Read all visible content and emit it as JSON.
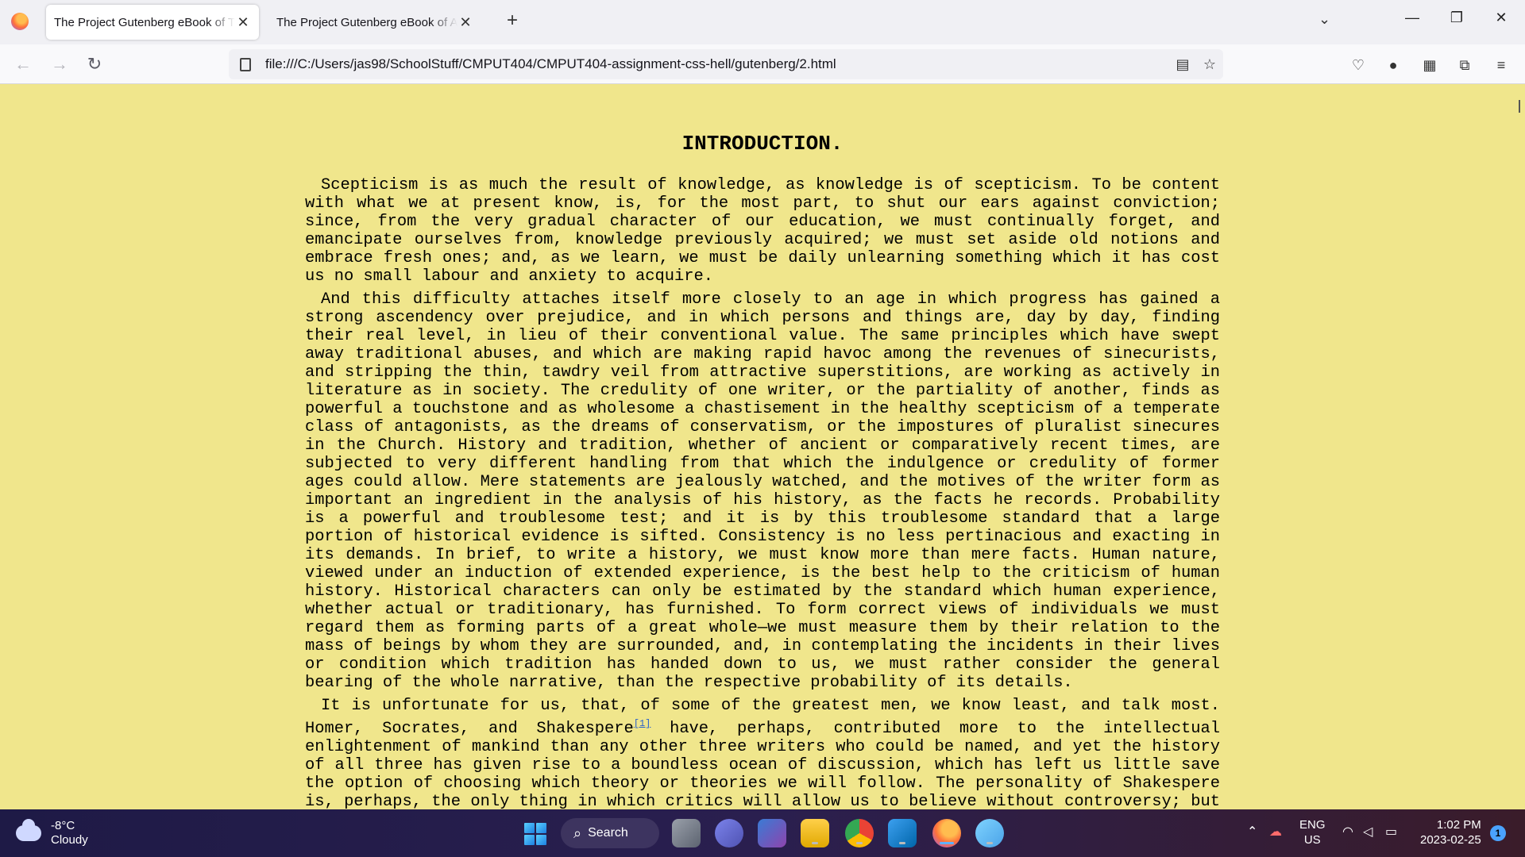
{
  "browser": {
    "tabs": [
      {
        "label": "The Project Gutenberg eBook of The",
        "active": true
      },
      {
        "label": "The Project Gutenberg eBook of An",
        "active": false
      }
    ],
    "url": "file:///C:/Users/jas98/SchoolStuff/CMPUT404/CMPUT404-assignment-css-hell/gutenberg/2.html"
  },
  "article": {
    "heading": "INTRODUCTION.",
    "p1": "Scepticism is as much the result of knowledge, as knowledge is of scepticism. To be content with what we at present know, is, for the most part, to shut our ears against conviction; since, from the very gradual character of our education, we must continually forget, and emancipate ourselves from, knowledge previously acquired; we must set aside old notions and embrace fresh ones; and, as we learn, we must be daily unlearning something which it has cost us no small labour and anxiety to acquire.",
    "p2": "And this difficulty attaches itself more closely to an age in which progress has gained a strong ascendency over prejudice, and in which persons and things are, day by day, finding their real level, in lieu of their conventional value. The same principles which have swept away traditional abuses, and which are making rapid havoc among the revenues of sinecurists, and stripping the thin, tawdry veil from attractive superstitions, are working as actively in literature as in society. The credulity of one writer, or the partiality of another, finds as powerful a touchstone and as wholesome a chastisement in the healthy scepticism of a temperate class of antagonists, as the dreams of conservatism, or the impostures of pluralist sinecures in the Church. History and tradition, whether of ancient or comparatively recent times, are subjected to very different handling from that which the indulgence or credulity of former ages could allow. Mere statements are jealously watched, and the motives of the writer form as important an ingredient in the analysis of his history, as the facts he records. Probability is a powerful and troublesome test; and it is by this troublesome standard that a large portion of historical evidence is sifted. Consistency is no less pertinacious and exacting in its demands. In brief, to write a history, we must know more than mere facts. Human nature, viewed under an induction of extended experience, is the best help to the criticism of human history. Historical characters can only be estimated by the standard which human experience, whether actual or traditionary, has furnished. To form correct views of individuals we must regard them as forming parts of a great whole—we must measure them by their relation to the mass of beings by whom they are surrounded, and, in contemplating the incidents in their lives or condition which tradition has handed down to us, we must rather consider the general bearing of the whole narrative, than the respective probability of its details.",
    "p3a": "It is unfortunate for us, that, of some of the greatest men, we know least, and talk most. Homer, Socrates, and Shakespere",
    "p3_fn": "[1]",
    "p3b": " have, perhaps, contributed more to the intellectual enlightenment of mankind than any other three writers who could be named, and yet the history of all three has given rise to a boundless ocean of discussion, which has left us little save the option of choosing which theory or theories we will follow. The personality of Shakespere is, perhaps, the only thing in which critics will allow us to believe without controversy; but upon"
  },
  "taskbar": {
    "temp": "-8°C",
    "condition": "Cloudy",
    "search_label": "Search",
    "lang1": "ENG",
    "lang2": "US",
    "time": "1:02 PM",
    "date": "2023-02-25",
    "notif_count": "1"
  }
}
